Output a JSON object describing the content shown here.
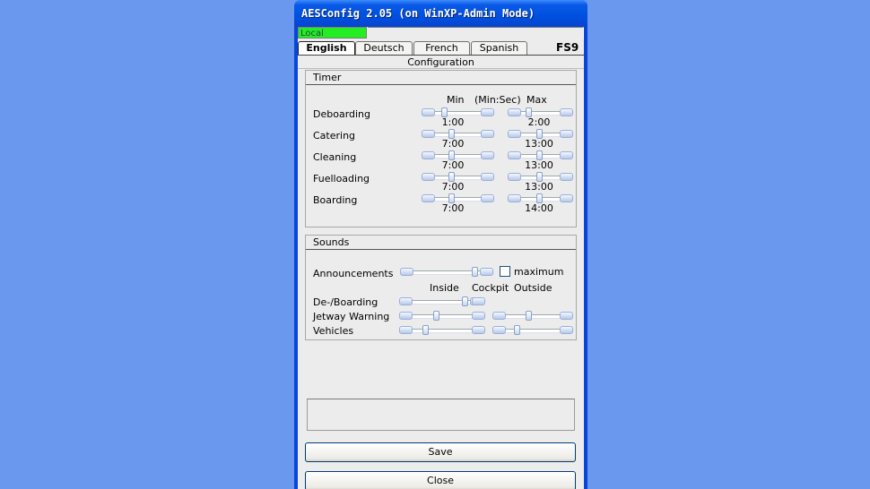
{
  "window": {
    "title": "AESConfig 2.05 (on WinXP-Admin Mode)"
  },
  "status": {
    "local_label": "Local"
  },
  "tabs": [
    {
      "label": "English",
      "active": true
    },
    {
      "label": "Deutsch",
      "active": false
    },
    {
      "label": "French",
      "active": false
    },
    {
      "label": "Spanish",
      "active": false
    }
  ],
  "sim_label": "FS9",
  "section_title": "Configuration",
  "timer": {
    "title": "Timer",
    "col_min": "Min",
    "col_unit": "(Min:Sec)",
    "col_max": "Max",
    "rows": [
      {
        "label": "Deboarding",
        "min": "1:00",
        "max": "2:00"
      },
      {
        "label": "Catering",
        "min": "7:00",
        "max": "13:00"
      },
      {
        "label": "Cleaning",
        "min": "7:00",
        "max": "13:00"
      },
      {
        "label": "Fuelloading",
        "min": "7:00",
        "max": "13:00"
      },
      {
        "label": "Boarding",
        "min": "7:00",
        "max": "14:00"
      }
    ]
  },
  "sounds": {
    "title": "Sounds",
    "announcements_label": "Announcements",
    "maximum_label": "maximum",
    "maximum_checked": false,
    "col_inside": "Inside",
    "col_cockpit": "Cockpit",
    "col_outside": "Outside",
    "rows": [
      {
        "label": "De-/Boarding"
      },
      {
        "label": "Jetway Warning"
      },
      {
        "label": "Vehicles"
      }
    ]
  },
  "buttons": {
    "save": "Save",
    "close": "Close"
  },
  "colors": {
    "titlebar": "#0050e0",
    "desktop": "#6b98ef",
    "local_indicator": "#22ee22"
  }
}
